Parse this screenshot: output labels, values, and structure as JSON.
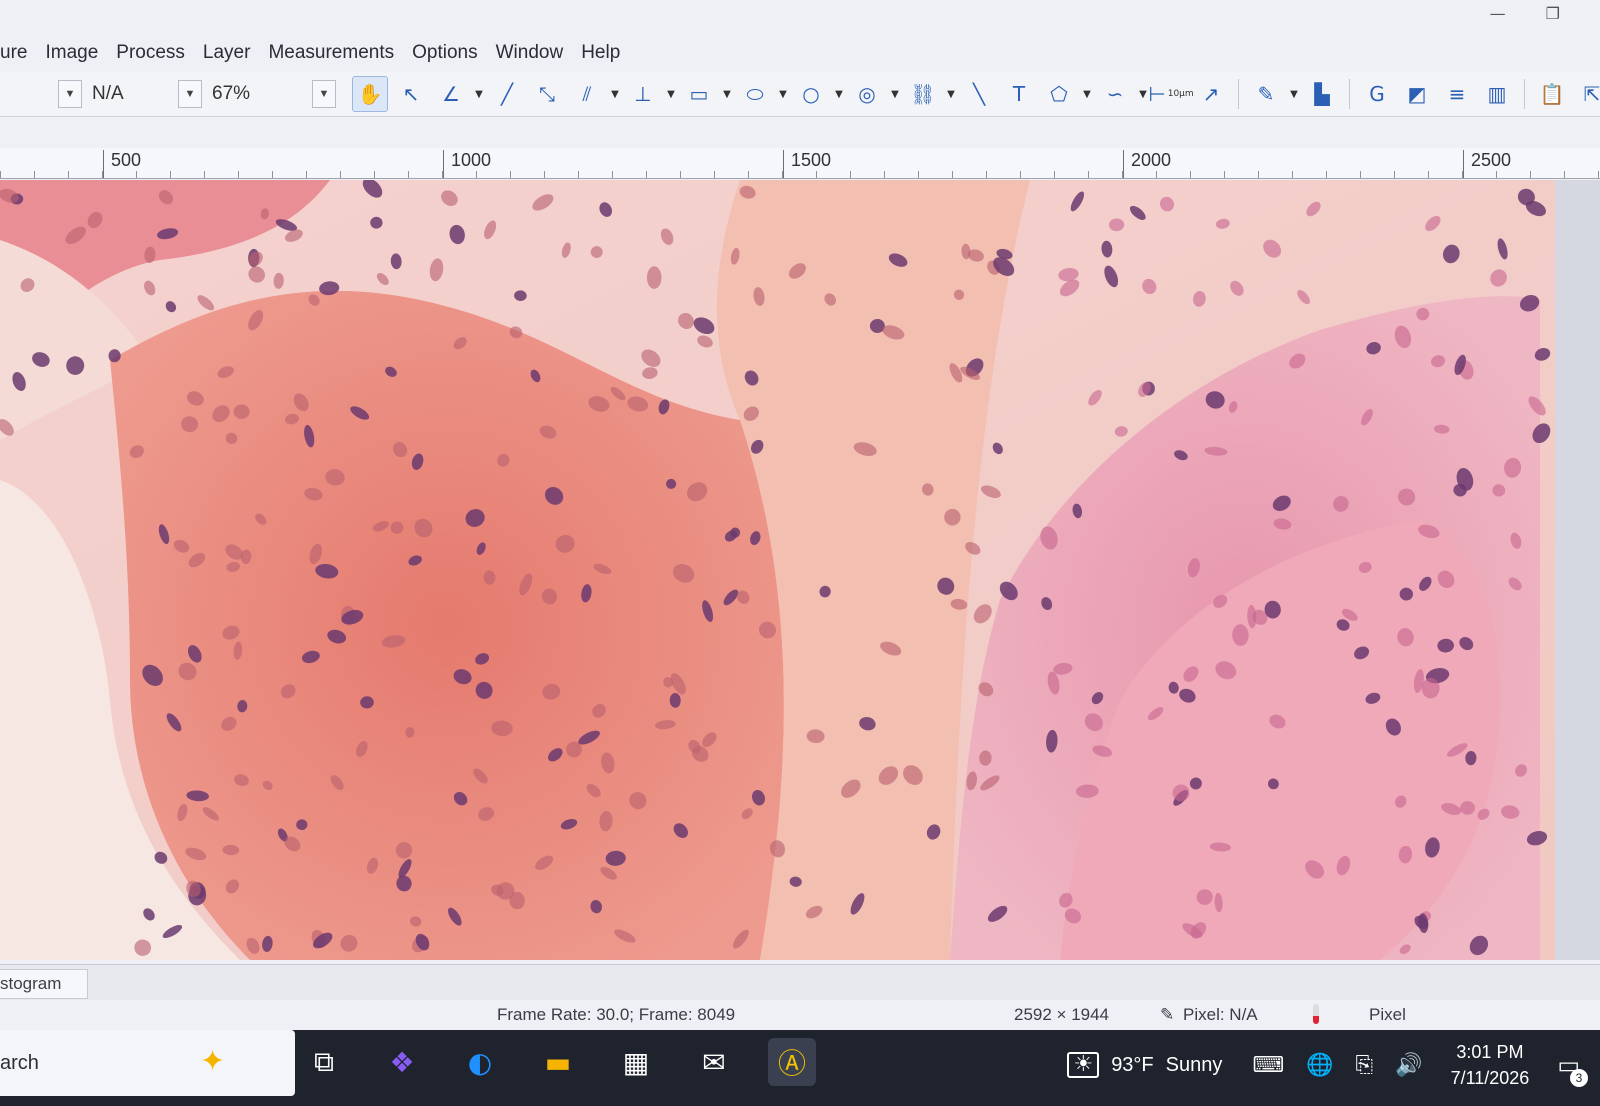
{
  "window_controls": {
    "minimize": "—",
    "maximize": "❐"
  },
  "menu": [
    "ure",
    "Image",
    "Process",
    "Layer",
    "Measurements",
    "Options",
    "Window",
    "Help"
  ],
  "toolbar": {
    "calibration_value": "N/A",
    "zoom_value": "67%",
    "tools": [
      {
        "icon": "hand-icon",
        "glyph": "✋",
        "active": true
      },
      {
        "icon": "pointer-icon",
        "glyph": "↖"
      },
      {
        "icon": "angle-icon",
        "glyph": "∠",
        "dropdown": true
      },
      {
        "icon": "line-icon",
        "glyph": "╱"
      },
      {
        "icon": "polyline-icon",
        "glyph": "⤡"
      },
      {
        "icon": "parallel-icon",
        "glyph": "⫽",
        "dropdown": true
      },
      {
        "icon": "perpendicular-icon",
        "glyph": "⊥",
        "dropdown": true
      },
      {
        "icon": "rectangle-icon",
        "glyph": "▭",
        "dropdown": true
      },
      {
        "icon": "ellipse-icon",
        "glyph": "⬭",
        "dropdown": true
      },
      {
        "icon": "circle-icon",
        "glyph": "○",
        "dropdown": true
      },
      {
        "icon": "concentric-circle-icon",
        "glyph": "◎",
        "dropdown": true
      },
      {
        "icon": "link-icon",
        "glyph": "⛓",
        "dropdown": true
      },
      {
        "icon": "arc-icon",
        "glyph": "╲"
      },
      {
        "icon": "text-icon",
        "glyph": "T"
      },
      {
        "icon": "polygon-icon",
        "glyph": "⬠",
        "dropdown": true
      },
      {
        "icon": "curve-icon",
        "glyph": "∽",
        "dropdown": true
      },
      {
        "icon": "scale-bar-icon",
        "glyph": "⊢",
        "label": "10µm"
      },
      {
        "icon": "arrow-icon",
        "glyph": "↗"
      },
      {
        "icon": "measure-settings-icon",
        "glyph": "✎",
        "dropdown": true
      },
      {
        "icon": "histogram-tool-icon",
        "glyph": "▙"
      },
      {
        "icon": "grid-icon",
        "glyph": "G"
      },
      {
        "icon": "layers-icon",
        "glyph": "◩"
      },
      {
        "icon": "align-icon",
        "glyph": "≡"
      },
      {
        "icon": "columns-icon",
        "glyph": "▥"
      },
      {
        "icon": "clipboard-icon",
        "glyph": "📋"
      },
      {
        "icon": "export-icon",
        "glyph": "⇱",
        "dropdown": true
      }
    ]
  },
  "ruler": {
    "labels": [
      "500",
      "1000",
      "1500",
      "2000",
      "2500"
    ]
  },
  "bottom_tab": {
    "label": "stogram"
  },
  "status": {
    "frame_info": "Frame Rate: 30.0; Frame: 8049",
    "resolution": "2592 × 1944",
    "pixel_size": "Pixel: N/A",
    "unit": "Pixel"
  },
  "taskbar": {
    "search_text": "arch",
    "apps": [
      {
        "name": "task-view-icon",
        "glyph": "⧉"
      },
      {
        "name": "copilot-icon",
        "glyph": "❖"
      },
      {
        "name": "edge-icon",
        "glyph": "◐"
      },
      {
        "name": "file-explorer-icon",
        "glyph": "▬"
      },
      {
        "name": "store-icon",
        "glyph": "▦"
      },
      {
        "name": "mail-icon",
        "glyph": "✉"
      },
      {
        "name": "capture-app-icon",
        "glyph": "Ⓐ",
        "active": true
      }
    ],
    "weather_temp": "93°F",
    "weather_desc": "Sunny",
    "time": "3:01 PM",
    "date": "7/11/2026",
    "notification_count": "3"
  },
  "colors": {
    "tissue_stroma": "#f2c3b6",
    "tissue_epithelium": "#e9868c",
    "nucleus": "#6b3a6f",
    "accent_blue": "#2b5fb4"
  }
}
